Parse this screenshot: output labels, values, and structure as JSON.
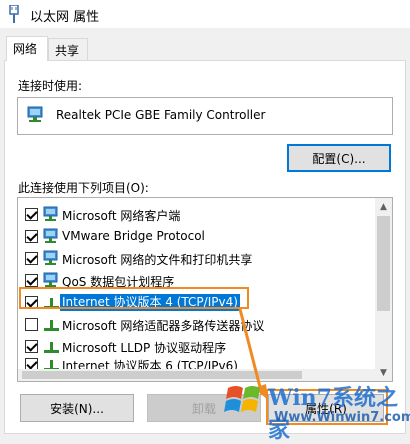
{
  "window": {
    "title": "以太网 属性"
  },
  "tabs": [
    {
      "label": "网络"
    },
    {
      "label": "共享"
    }
  ],
  "connect_using_label": "连接时使用:",
  "adapter": {
    "name": "Realtek PCIe GBE Family Controller"
  },
  "configure_label": "配置(C)...",
  "items_label": "此连接使用下列项目(O):",
  "items": [
    {
      "label": "Microsoft 网络客户端",
      "checked": true,
      "icon": "network-client-icon"
    },
    {
      "label": "VMware Bridge Protocol",
      "checked": true,
      "icon": "network-service-icon"
    },
    {
      "label": "Microsoft 网络的文件和打印机共享",
      "checked": true,
      "icon": "network-service-icon"
    },
    {
      "label": "QoS 数据包计划程序",
      "checked": true,
      "icon": "network-service-icon"
    },
    {
      "label": "Internet 协议版本 4 (TCP/IPv4)",
      "checked": true,
      "icon": "protocol-icon",
      "selected": true
    },
    {
      "label": "Microsoft 网络适配器多路传送器协议",
      "checked": false,
      "icon": "protocol-icon"
    },
    {
      "label": "Microsoft LLDP 协议驱动程序",
      "checked": true,
      "icon": "protocol-icon"
    },
    {
      "label": "Internet 协议版本 6 (TCP/IPv6)",
      "checked": true,
      "icon": "protocol-icon"
    }
  ],
  "buttons": {
    "install": "安装(N)...",
    "uninstall": "卸载",
    "properties": "属性(R)"
  },
  "watermark": {
    "logo": "Win7系统之家",
    "url": "Www.Winwin7.com"
  },
  "colors": {
    "selection": "#0078d7",
    "annotation": "#f08a24"
  }
}
